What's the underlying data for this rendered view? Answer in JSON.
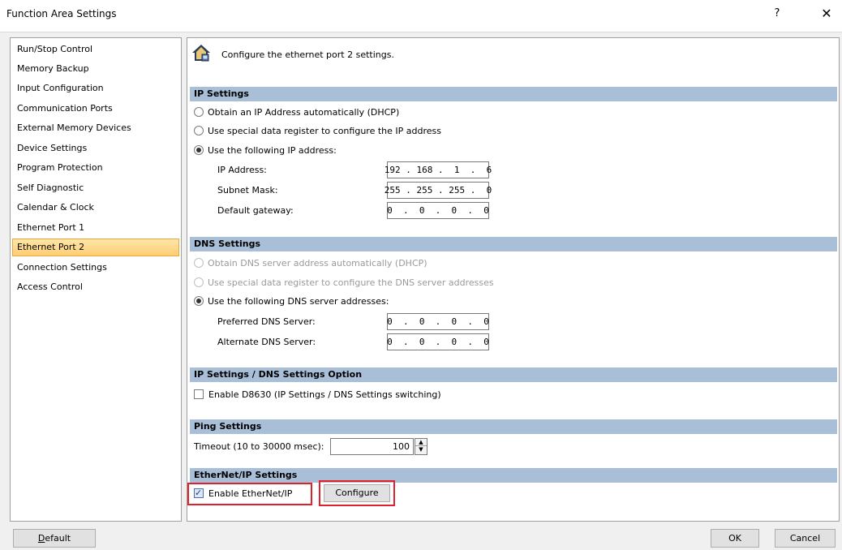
{
  "window": {
    "title": "Function Area Settings",
    "help_glyph": "?",
    "close_glyph": "✕"
  },
  "nav": {
    "items": [
      "Run/Stop Control",
      "Memory Backup",
      "Input Configuration",
      "Communication Ports",
      "External Memory Devices",
      "Device Settings",
      "Program Protection",
      "Self Diagnostic",
      "Calendar & Clock",
      "Ethernet Port 1",
      "Ethernet Port 2",
      "Connection Settings",
      "Access Control"
    ],
    "selected": "Ethernet Port 2"
  },
  "header": {
    "icon": "house-network-icon",
    "text": "Configure the ethernet port 2 settings."
  },
  "ip_settings": {
    "title": "IP Settings",
    "options": [
      "Obtain an IP Address automatically (DHCP)",
      "Use special data register to configure the IP address",
      "Use the following IP address:"
    ],
    "selected_index": 2,
    "ip_address_label": "IP Address:",
    "ip_address": "192 . 168 .  1  .  6",
    "subnet_label": "Subnet Mask:",
    "subnet": "255 . 255 . 255 .  0",
    "gateway_label": "Default gateway:",
    "gateway": "0  .  0  .  0  .  0"
  },
  "dns_settings": {
    "title": "DNS Settings",
    "options": [
      "Obtain DNS server address automatically (DHCP)",
      "Use special data register to configure the DNS server addresses",
      "Use the following DNS server addresses:"
    ],
    "selected_index": 2,
    "preferred_label": "Preferred DNS Server:",
    "preferred": "0  .  0  .  0  .  0",
    "alternate_label": "Alternate DNS Server:",
    "alternate": "0  .  0  .  0  .  0"
  },
  "option_settings": {
    "title": "IP Settings / DNS Settings Option",
    "enable_label": "Enable D8630 (IP Settings / DNS Settings switching)",
    "enabled": false
  },
  "ping_settings": {
    "title": "Ping Settings",
    "timeout_label": "Timeout (10 to 30000 msec):",
    "timeout_value": "100"
  },
  "ethernetip_settings": {
    "title": "EtherNet/IP Settings",
    "enable_label": "Enable EtherNet/IP",
    "enabled": true,
    "configure_label": "Configure"
  },
  "footer": {
    "default_label": "Default",
    "ok_label": "OK",
    "cancel_label": "Cancel"
  },
  "colors": {
    "section_bg": "#a9bfd8",
    "selected_item": "#ffcd73",
    "highlight": "#e0202a"
  }
}
